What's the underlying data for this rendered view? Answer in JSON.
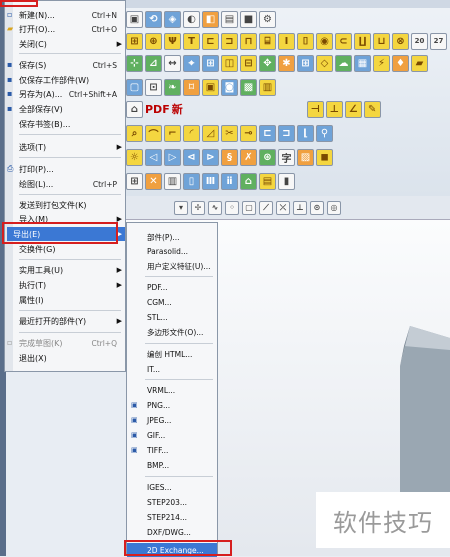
{
  "file_menu": {
    "items": [
      {
        "label": "新建(N)...",
        "shortcut": "Ctrl+N"
      },
      {
        "label": "打开(O)...",
        "shortcut": "Ctrl+O"
      },
      {
        "label": "关闭(C)"
      },
      {
        "label": "保存(S)",
        "shortcut": "Ctrl+S"
      },
      {
        "label": "仅保存工作部件(W)"
      },
      {
        "label": "另存为(A)...",
        "shortcut": "Ctrl+Shift+A"
      },
      {
        "label": "全部保存(V)"
      },
      {
        "label": "保存书签(B)..."
      },
      {
        "label": "选项(T)"
      },
      {
        "label": "打印(P)..."
      },
      {
        "label": "绘图(L)...",
        "shortcut": "Ctrl+P"
      },
      {
        "label": "发送到打包文件(K)"
      },
      {
        "label": "导入(M)"
      },
      {
        "label": "导出(E)"
      },
      {
        "label": "交换件(G)"
      },
      {
        "label": "实用工具(U)"
      },
      {
        "label": "执行(T)"
      },
      {
        "label": "属性(I)"
      },
      {
        "label": "最近打开的部件(Y)"
      },
      {
        "label": "完成草图(K)",
        "shortcut": "Ctrl+Q"
      },
      {
        "label": "退出(X)"
      }
    ]
  },
  "export_submenu": {
    "items": [
      "部件(P)...",
      "Parasolid...",
      "用户定义特征(U)...",
      "PDF...",
      "CGM...",
      "STL...",
      "多边形文件(O)...",
      "编创 HTML...",
      "IT...",
      "VRML...",
      "PNG...",
      "JPEG...",
      "GIF...",
      "TIFF...",
      "BMP...",
      "IGES...",
      "STEP203...",
      "STEP214...",
      "DXF/DWG...",
      "2D Exchange..."
    ]
  },
  "toolbar": {
    "pdf_label": "PDF",
    "new_label": "新",
    "text_a": "字",
    "number_20": "20",
    "number_27": "27"
  },
  "watermark": "软件技巧",
  "colors": {
    "highlight": "#3b78d4",
    "annotation": "#d61e1e"
  }
}
